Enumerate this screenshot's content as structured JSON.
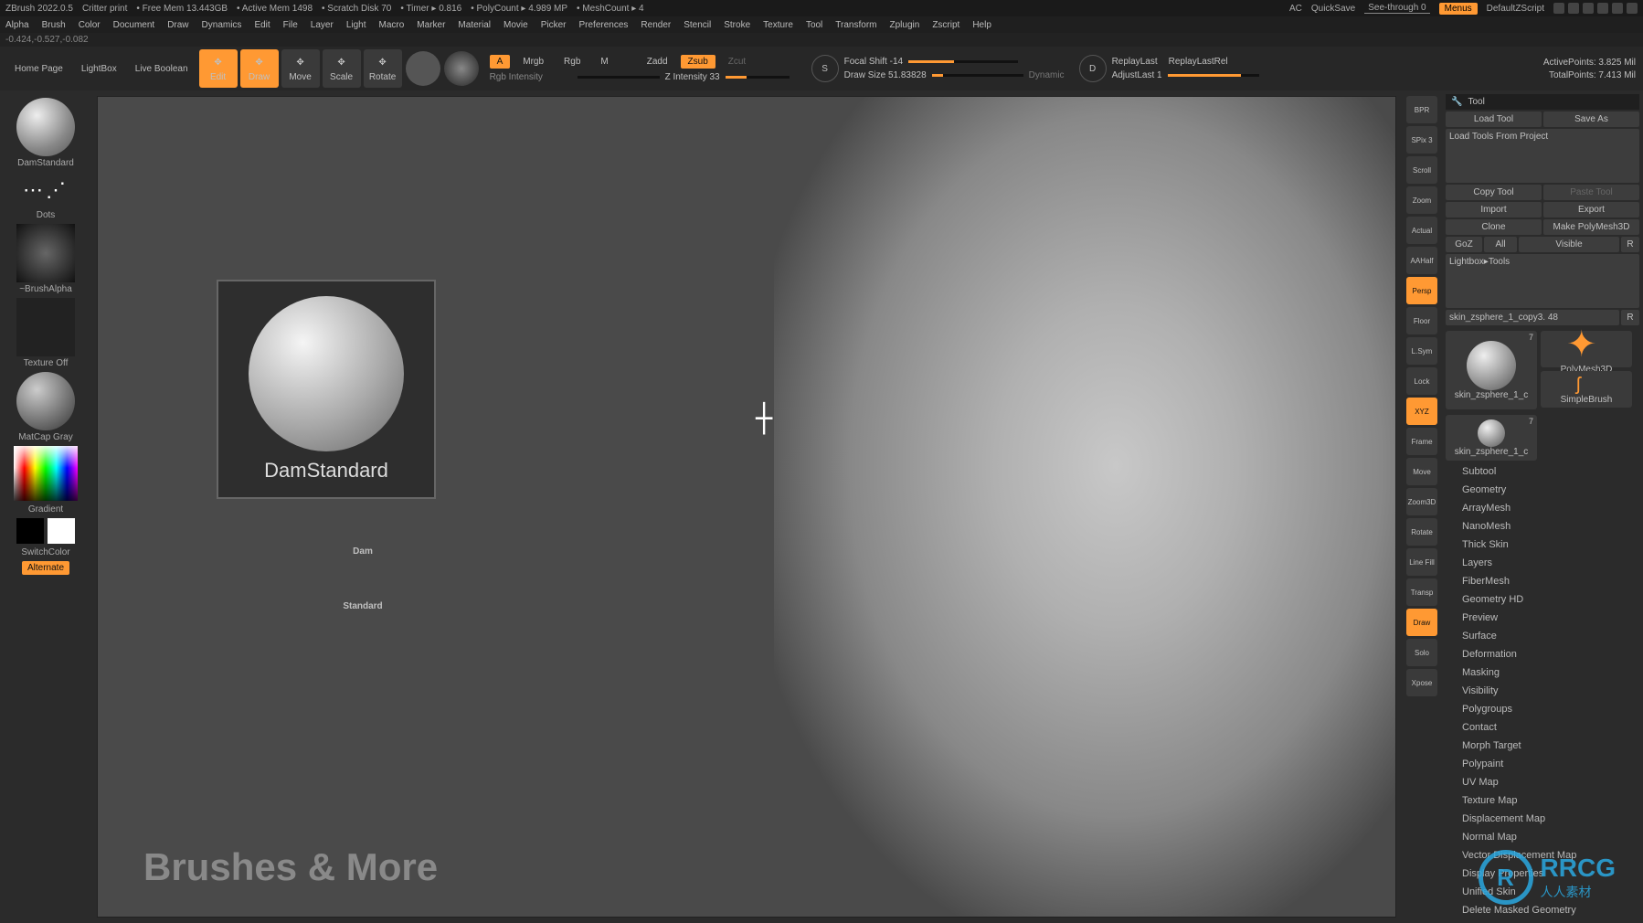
{
  "titlebar": {
    "app": "ZBrush 2022.0.5",
    "project": "Critter print",
    "freemem": "• Free Mem 13.443GB",
    "activemem": "• Active Mem 1498",
    "scratch": "• Scratch Disk 70",
    "timer": "• Timer ▸ 0.816",
    "polycount": "• PolyCount ▸ 4.989 MP",
    "meshcount": "• MeshCount ▸ 4",
    "ac": "AC",
    "quicksave": "QuickSave",
    "seethrough": "See-through  0",
    "menus": "Menus",
    "zscript": "DefaultZScript"
  },
  "menubar": [
    "Alpha",
    "Brush",
    "Color",
    "Document",
    "Draw",
    "Dynamics",
    "Edit",
    "File",
    "Layer",
    "Light",
    "Macro",
    "Marker",
    "Material",
    "Movie",
    "Picker",
    "Preferences",
    "Render",
    "Stencil",
    "Stroke",
    "Texture",
    "Tool",
    "Transform",
    "Zplugin",
    "Zscript",
    "Help"
  ],
  "coords": "-0.424,-0.527,-0.082",
  "toolbar": {
    "homepage": "Home Page",
    "lightbox": "LightBox",
    "livebool": "Live Boolean",
    "modes": [
      {
        "label": "Edit",
        "active": true
      },
      {
        "label": "Draw",
        "active": true
      },
      {
        "label": "Move",
        "active": false
      },
      {
        "label": "Scale",
        "active": false
      },
      {
        "label": "Rotate",
        "active": false
      }
    ],
    "a": "A",
    "mrgb": "Mrgb",
    "rgb": "Rgb",
    "m": "M",
    "zadd": "Zadd",
    "zsub": "Zsub",
    "zcut": "Zcut",
    "rgbint": "Rgb Intensity",
    "zint": "Z Intensity 33",
    "focal": "Focal Shift -14",
    "drawsize": "Draw Size 51.83828",
    "dynamic": "Dynamic",
    "replay": "ReplayLast",
    "replayrel": "ReplayLastRel",
    "adjust": "AdjustLast 1",
    "active": "ActivePoints: 3.825 Mil",
    "total": "TotalPoints: 7.413 Mil",
    "s": "S",
    "d": "D"
  },
  "ldock": {
    "brush": "DamStandard",
    "stroke": "Dots",
    "alpha": "~BrushAlpha",
    "texture": "Texture Off",
    "material": "MatCap Gray",
    "gradient": "Gradient",
    "switch": "SwitchColor",
    "alt": "Alternate"
  },
  "canvas": {
    "caption": "DamStandard",
    "big1": "Dam",
    "big2": "Standard",
    "sub": "Brushes & More"
  },
  "rstrip": [
    {
      "l": "BPR",
      "on": false
    },
    {
      "l": "SPix 3",
      "on": false
    },
    {
      "l": "Scroll",
      "on": false
    },
    {
      "l": "Zoom",
      "on": false
    },
    {
      "l": "Actual",
      "on": false
    },
    {
      "l": "AAHalf",
      "on": false
    },
    {
      "l": "Persp",
      "on": true
    },
    {
      "l": "Floor",
      "on": false
    },
    {
      "l": "L.Sym",
      "on": false
    },
    {
      "l": "Lock",
      "on": false
    },
    {
      "l": "XYZ",
      "on": true
    },
    {
      "l": "Frame",
      "on": false
    },
    {
      "l": "Move",
      "on": false
    },
    {
      "l": "Zoom3D",
      "on": false
    },
    {
      "l": "Rotate",
      "on": false
    },
    {
      "l": "Line Fill",
      "on": false
    },
    {
      "l": "Transp",
      "on": false
    },
    {
      "l": "Draw",
      "on": true
    },
    {
      "l": "Solo",
      "on": false
    },
    {
      "l": "Xpose",
      "on": false
    }
  ],
  "rpanel": {
    "title": "Tool",
    "buttons": {
      "load": "Load Tool",
      "save": "Save As",
      "loadproj": "Load Tools From Project",
      "copy": "Copy Tool",
      "paste": "Paste Tool",
      "import": "Import",
      "export": "Export",
      "clone": "Clone",
      "makepoly": "Make PolyMesh3D",
      "goz": "GoZ",
      "all": "All",
      "visible": "Visible",
      "r": "R",
      "lightbox": "Lightbox▸Tools",
      "toolname": "skin_zsphere_1_copy3. 48"
    },
    "thumbs": {
      "t1": "skin_zsphere_1_c",
      "t1n": "7",
      "t2": "PolyMesh3D",
      "t3": "SimpleBrush",
      "t4": "skin_zsphere_1_c",
      "t4n": "7"
    },
    "sections": [
      "Subtool",
      "Geometry",
      "ArrayMesh",
      "NanoMesh",
      "Thick Skin",
      "Layers",
      "FiberMesh",
      "Geometry HD",
      "Preview",
      "Surface",
      "Deformation",
      "Masking",
      "Visibility",
      "Polygroups",
      "Contact",
      "Morph Target",
      "Polypaint",
      "UV Map",
      "Texture Map",
      "Displacement Map",
      "Normal Map",
      "Vector Displacement Map",
      "Display Properties",
      "Unified Skin",
      "Delete Masked Geometry"
    ]
  },
  "wm": {
    "logo": "R",
    "txt": "RRCG",
    "sub": "人人素材"
  }
}
